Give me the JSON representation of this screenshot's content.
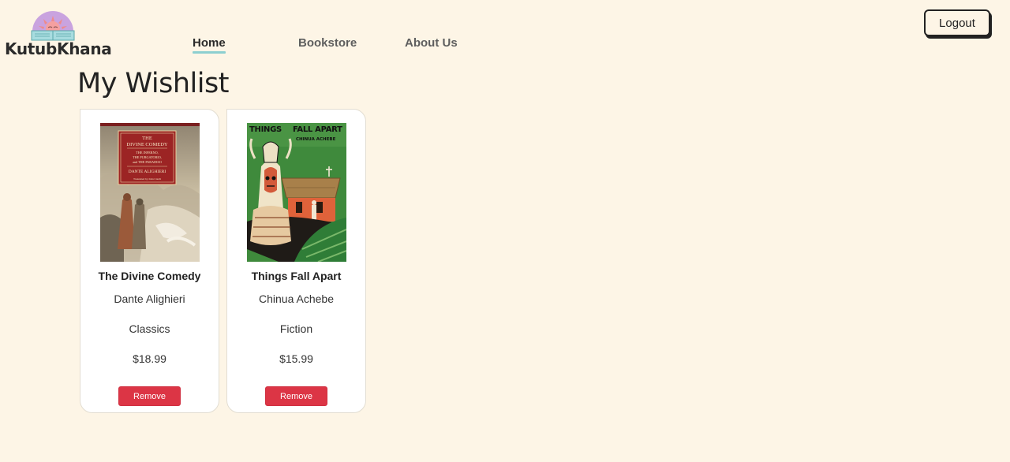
{
  "brand": {
    "name": "KutubKhana",
    "logo_icon": "sun-reader-logo-icon"
  },
  "nav": {
    "items": [
      {
        "label": "Home",
        "active": true
      },
      {
        "label": "Bookstore",
        "active": false
      },
      {
        "label": "About Us",
        "active": false
      }
    ],
    "underline_color": "#8ccfd0"
  },
  "header": {
    "logout_label": "Logout"
  },
  "page": {
    "title": "My Wishlist"
  },
  "wishlist": [
    {
      "title": "The Divine Comedy",
      "author": "Dante Alighieri",
      "genre": "Classics",
      "price": "$18.99",
      "remove_label": "Remove",
      "cover": {
        "title_line": "THE DIVINE COMEDY",
        "subtitle_lines": [
          "THE INFERNO,",
          "THE PURGATORIO,",
          "and THE PARADISO"
        ],
        "author_line": "DANTE ALIGHIERI",
        "translator_line": "Translated by John Ciardi"
      }
    },
    {
      "title": "Things Fall Apart",
      "author": "Chinua Achebe",
      "genre": "Fiction",
      "price": "$15.99",
      "remove_label": "Remove",
      "cover": {
        "title_line": "THINGS FALL APART",
        "author_line": "CHINUA ACHEBE"
      }
    }
  ],
  "colors": {
    "background": "#fdf5e6",
    "remove_button": "#dc3545",
    "card": "#ffffff"
  }
}
